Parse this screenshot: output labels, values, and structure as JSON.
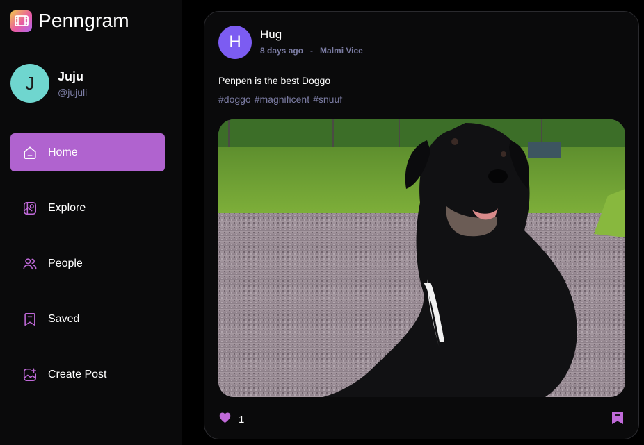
{
  "app": {
    "name": "Penngram"
  },
  "profile": {
    "initial": "J",
    "name": "Juju",
    "handle": "@jujuli"
  },
  "nav": [
    {
      "id": "home",
      "label": "Home",
      "icon": "home-icon",
      "active": true
    },
    {
      "id": "explore",
      "label": "Explore",
      "icon": "gallery-icon",
      "active": false
    },
    {
      "id": "people",
      "label": "People",
      "icon": "people-icon",
      "active": false
    },
    {
      "id": "saved",
      "label": "Saved",
      "icon": "bookmark-icon",
      "active": false
    },
    {
      "id": "create-post",
      "label": "Create Post",
      "icon": "add-image-icon",
      "active": false
    }
  ],
  "post": {
    "author_initial": "H",
    "author": "Hug",
    "time": "8 days ago",
    "separator": "-",
    "location": "Malmi Vice",
    "caption": "Penpen is the best Doggo",
    "tags": [
      "#doggo",
      "#magnificent",
      "#snuuf"
    ],
    "likes": "1"
  },
  "colors": {
    "accent": "#b063cf",
    "muted": "#7b7ca3",
    "background": "#000000",
    "surface": "#0a0a0b",
    "profile_avatar": "#6fd6cf",
    "author_avatar": "#7c5cf2"
  }
}
